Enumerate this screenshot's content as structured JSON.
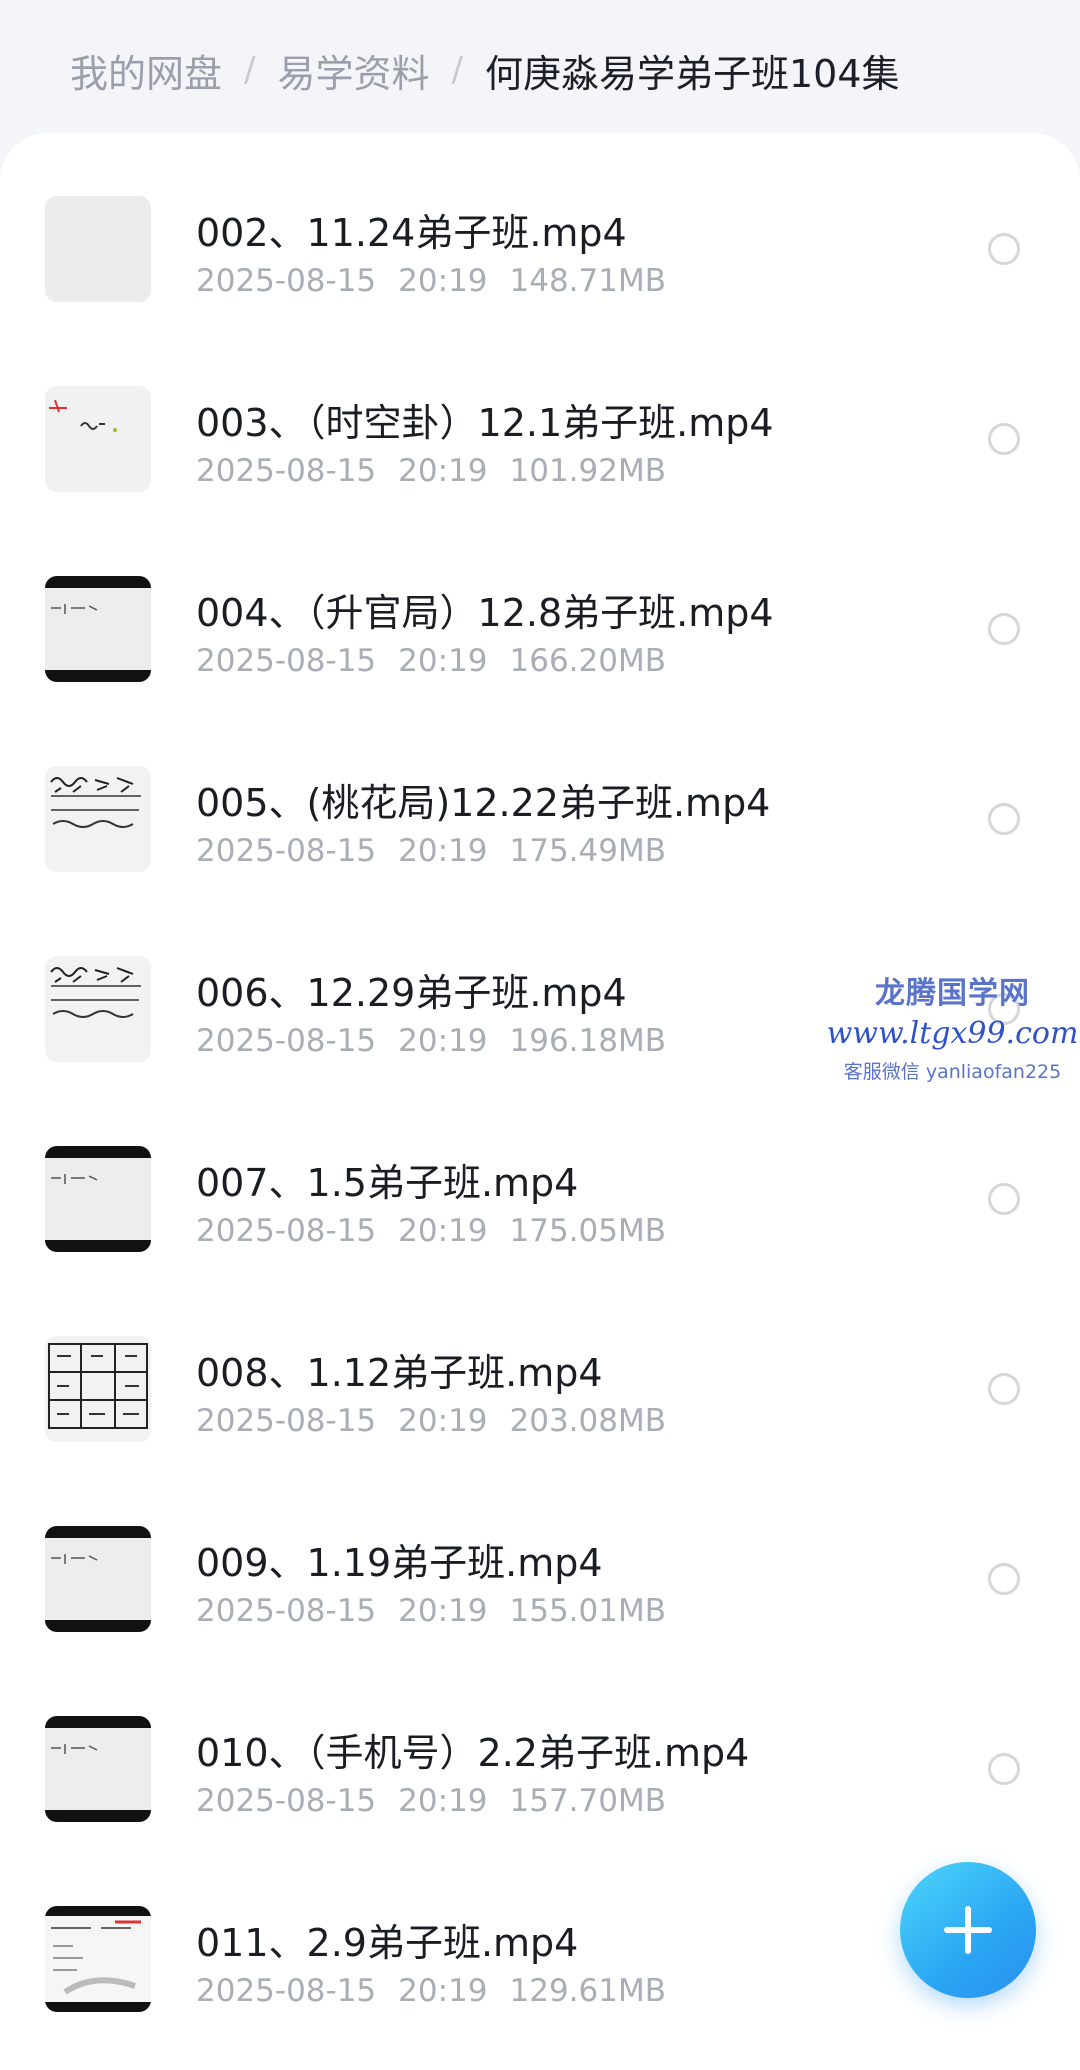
{
  "breadcrumb": {
    "root": "我的网盘",
    "parent": "易学资料",
    "current": "何庚淼易学弟子班104集",
    "separator": "/"
  },
  "files": [
    {
      "name": "002、11.24弟子班.mp4",
      "date": "2025-08-15",
      "time": "20:19",
      "size": "148.71MB",
      "thumb": "blank-thumbnail-icon"
    },
    {
      "name": "003、（时空卦）12.1弟子班.mp4",
      "date": "2025-08-15",
      "time": "20:19",
      "size": "101.92MB",
      "thumb": "whiteboard-thumbnail-icon"
    },
    {
      "name": "004、（升官局）12.8弟子班.mp4",
      "date": "2025-08-15",
      "time": "20:19",
      "size": "166.20MB",
      "thumb": "letterbox-thumbnail-icon"
    },
    {
      "name": "005、(桃花局)12.22弟子班.mp4",
      "date": "2025-08-15",
      "time": "20:19",
      "size": "175.49MB",
      "thumb": "handwriting-thumbnail-icon"
    },
    {
      "name": "006、12.29弟子班.mp4",
      "date": "2025-08-15",
      "time": "20:19",
      "size": "196.18MB",
      "thumb": "handwriting-thumbnail-icon"
    },
    {
      "name": "007、1.5弟子班.mp4",
      "date": "2025-08-15",
      "time": "20:19",
      "size": "175.05MB",
      "thumb": "letterbox-thumbnail-icon"
    },
    {
      "name": "008、1.12弟子班.mp4",
      "date": "2025-08-15",
      "time": "20:19",
      "size": "203.08MB",
      "thumb": "grid-thumbnail-icon"
    },
    {
      "name": "009、1.19弟子班.mp4",
      "date": "2025-08-15",
      "time": "20:19",
      "size": "155.01MB",
      "thumb": "letterbox-thumbnail-icon"
    },
    {
      "name": "010、（手机号）2.2弟子班.mp4",
      "date": "2025-08-15",
      "time": "20:19",
      "size": "157.70MB",
      "thumb": "letterbox-thumbnail-icon"
    },
    {
      "name": "011、2.9弟子班.mp4",
      "date": "2025-08-15",
      "time": "20:19",
      "size": "129.61MB",
      "thumb": "slide-thumbnail-icon"
    }
  ],
  "watermark": {
    "title": "龙腾国学网",
    "url": "www.ltgx99.com",
    "contact": "客服微信 yanliaofan225"
  },
  "fab": {
    "icon": "plus-icon",
    "color": "#2aa6f3"
  },
  "colors": {
    "accent": "#2aa6f3",
    "text_primary": "#1a1d24",
    "text_secondary": "#a9adb5"
  }
}
